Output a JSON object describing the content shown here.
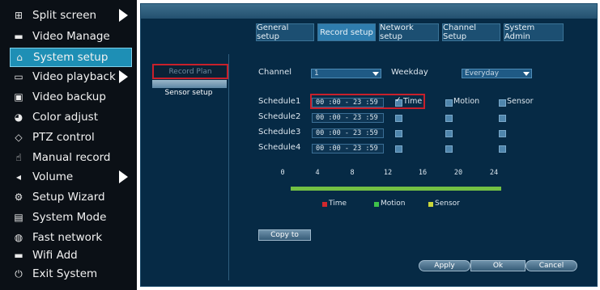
{
  "menu": {
    "items": [
      {
        "label": "Split screen",
        "icon": "split-screen-icon",
        "glyph": "⊞",
        "arrow": true
      },
      {
        "label": "Video Manage",
        "icon": "camera-icon",
        "glyph": "▬",
        "arrow": false
      },
      {
        "label": "System setup",
        "icon": "home-icon",
        "glyph": "⌂",
        "arrow": false,
        "selected": true
      },
      {
        "label": "Video playback",
        "icon": "playback-icon",
        "glyph": "▭",
        "arrow": true
      },
      {
        "label": "Video backup",
        "icon": "save-icon",
        "glyph": "▣",
        "arrow": false
      },
      {
        "label": "Color adjust",
        "icon": "palette-icon",
        "glyph": "◕",
        "arrow": false
      },
      {
        "label": "PTZ control",
        "icon": "ptz-icon",
        "glyph": "◇",
        "arrow": false
      },
      {
        "label": "Manual record",
        "icon": "hand-icon",
        "glyph": "☝",
        "arrow": false
      },
      {
        "label": "Volume",
        "icon": "speaker-icon",
        "glyph": "◂",
        "arrow": true
      },
      {
        "label": "Setup Wizard",
        "icon": "wizard-icon",
        "glyph": "⚙",
        "arrow": false
      },
      {
        "label": "System Mode",
        "icon": "document-icon",
        "glyph": "▤",
        "arrow": false
      },
      {
        "label": "Fast network",
        "icon": "globe-icon",
        "glyph": "◍",
        "arrow": false
      },
      {
        "label": "Wifi Add",
        "icon": "wifi-camera-icon",
        "glyph": "▬",
        "arrow": false
      },
      {
        "label": "Exit System",
        "icon": "power-icon",
        "glyph": "⏻",
        "arrow": false
      }
    ]
  },
  "tabs": [
    {
      "label": "General setup",
      "active": false
    },
    {
      "label": "Record setup",
      "active": true
    },
    {
      "label": "Network setup",
      "active": false
    },
    {
      "label": "Channel Setup",
      "active": false
    },
    {
      "label": "System Admin",
      "active": false
    }
  ],
  "sidebar": {
    "record_plan": "Record Plan",
    "sensor_setup": "Sensor setup"
  },
  "form": {
    "channel_label": "Channel",
    "channel_value": "1",
    "weekday_label": "Weekday",
    "weekday_value": "Everyday"
  },
  "schedules": [
    {
      "label": "Schedule1",
      "time": "00 :00 - 23 :59",
      "time_checked": true,
      "motion_checked": false,
      "sensor_checked": false
    },
    {
      "label": "Schedule2",
      "time": "00 :00 - 23 :59",
      "time_checked": false,
      "motion_checked": false,
      "sensor_checked": false
    },
    {
      "label": "Schedule3",
      "time": "00 :00 - 23 :59",
      "time_checked": false,
      "motion_checked": false,
      "sensor_checked": false
    },
    {
      "label": "Schedule4",
      "time": "00 :00 - 23 :59",
      "time_checked": false,
      "motion_checked": false,
      "sensor_checked": false
    }
  ],
  "trigger_labels": {
    "time": "Time",
    "motion": "Motion",
    "sensor": "Sensor"
  },
  "timeline": {
    "ticks": [
      "0",
      "4",
      "8",
      "12",
      "16",
      "20",
      "24"
    ],
    "bar_color": "#73c043"
  },
  "legend": [
    {
      "label": "Time",
      "color": "#d0282e"
    },
    {
      "label": "Motion",
      "color": "#3fc24a"
    },
    {
      "label": "Sensor",
      "color": "#c9d63a"
    }
  ],
  "buttons": {
    "copy_to": "Copy to",
    "apply": "Apply",
    "ok": "Ok",
    "cancel": "Cancel"
  },
  "colors": {
    "accent": "#1e8fb5",
    "panel_bg": "#062a45",
    "highlight": "#c8202b"
  }
}
